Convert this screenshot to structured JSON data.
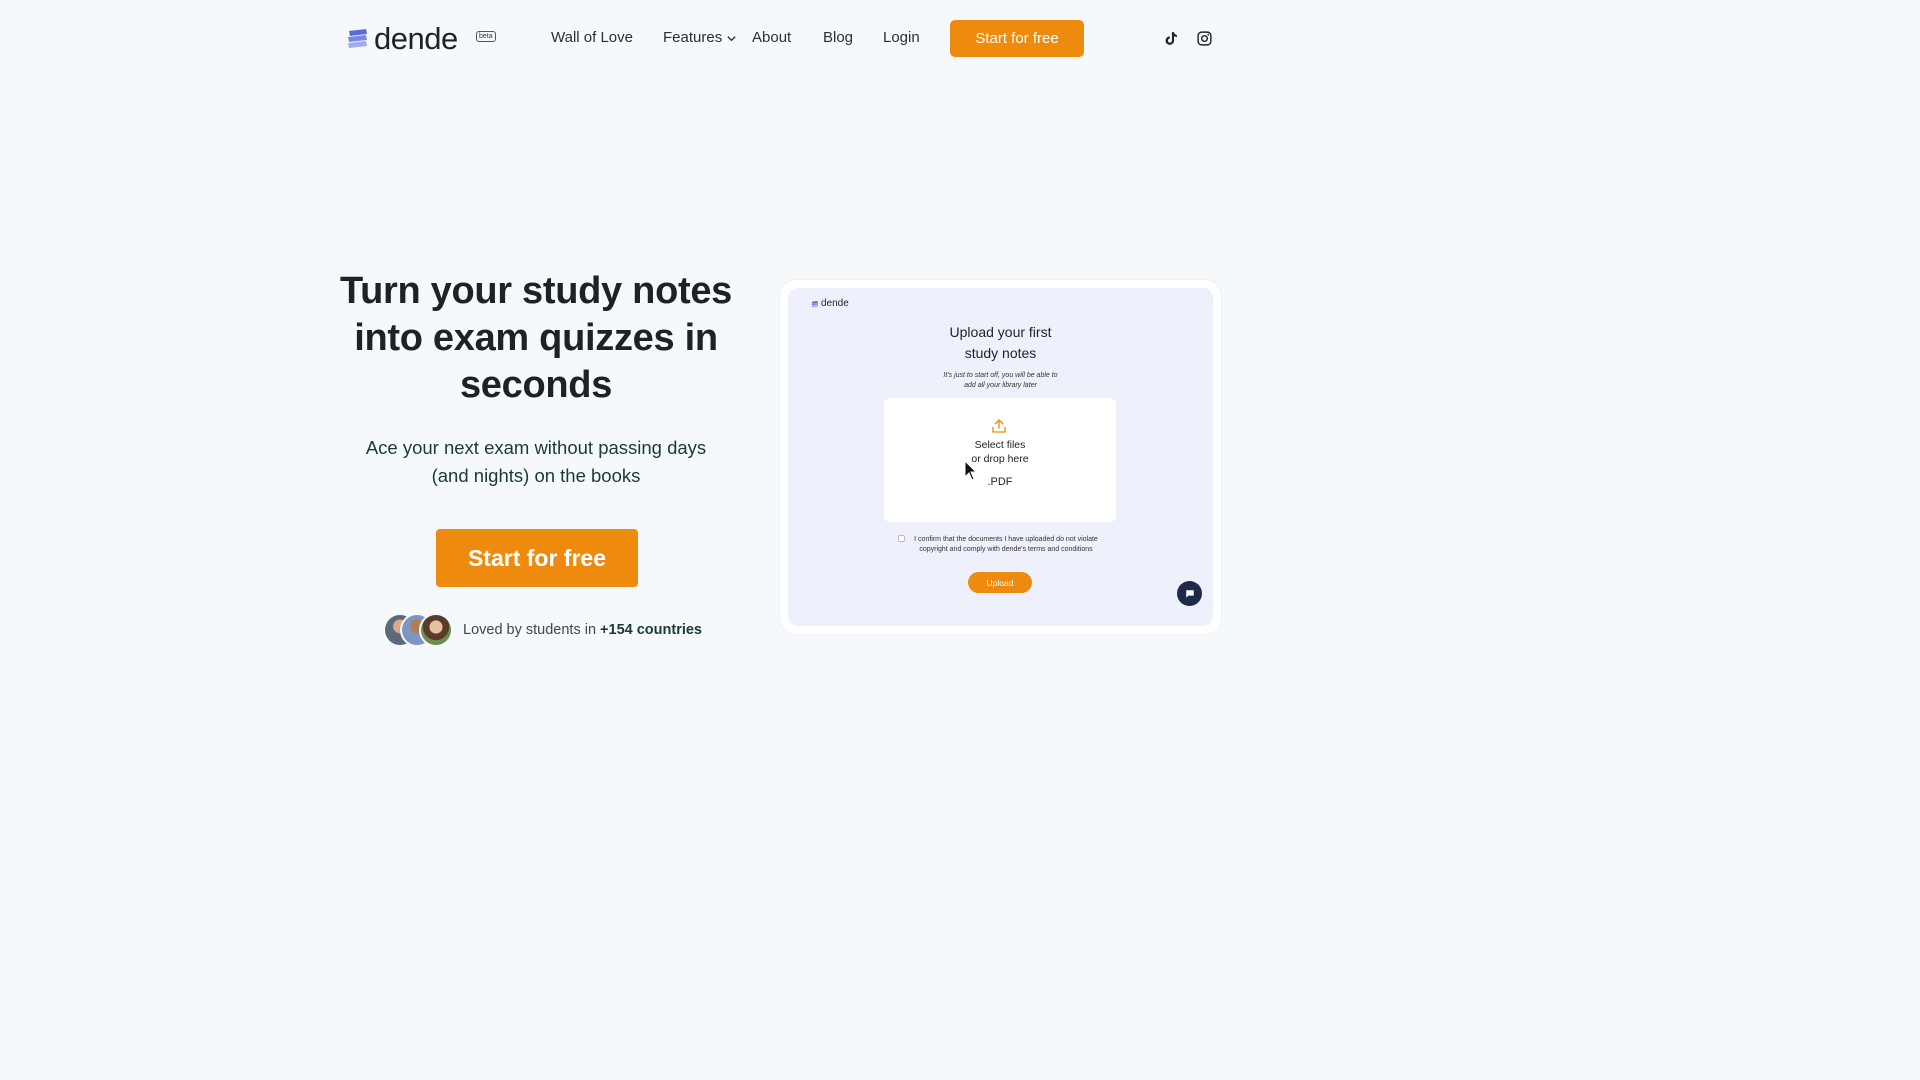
{
  "nav": {
    "logo_text": "dende",
    "beta_label": "beta",
    "links": [
      {
        "label": "Wall of Love"
      },
      {
        "label": "Features"
      },
      {
        "label": "About"
      },
      {
        "label": "Blog"
      },
      {
        "label": "Login"
      }
    ],
    "cta_label": "Start for free",
    "social_icons": [
      "tiktok-icon",
      "instagram-icon"
    ]
  },
  "hero": {
    "title": "Turn your study notes into exam quizzes in seconds",
    "subtitle": "Ace your next exam without passing days (and nights) on the books",
    "cta_label": "Start for free",
    "proof_prefix": "Loved by students in ",
    "proof_highlight": "+154 countries"
  },
  "mockup": {
    "logo_text": "dende",
    "title_line1": "Upload your first",
    "title_line2": "study notes",
    "note_line1": "It's just to start off, you will be able to",
    "note_line2": "add all your library later",
    "dropzone_line1": "Select files",
    "dropzone_line2": "or drop here",
    "file_format": ".PDF",
    "terms_line1": "I confirm that the documents I have uploaded do not violate",
    "terms_line2": "copyright and comply with dende's terms and conditions",
    "upload_label": "Upload"
  },
  "colors": {
    "accent": "#ee8b0e",
    "background": "#f6f9fb",
    "heading": "#1e2126",
    "subtext": "#1b3a33",
    "mock_screen": "#eef0fb"
  }
}
